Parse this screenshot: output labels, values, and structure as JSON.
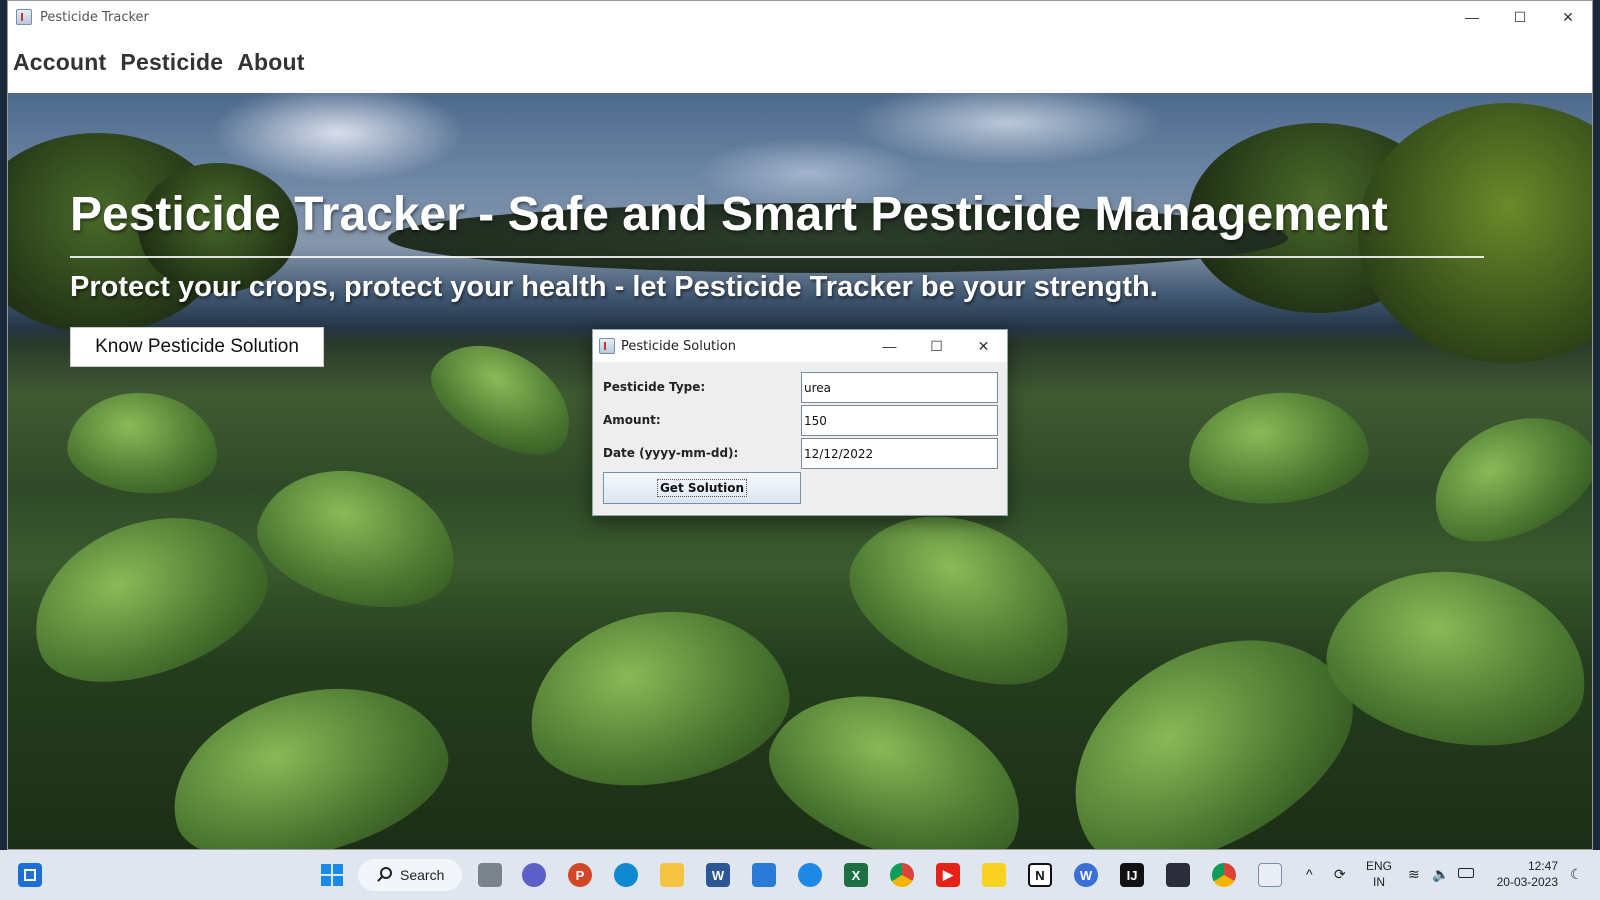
{
  "window": {
    "title": "Pesticide Tracker",
    "controls": {
      "minimize": "—",
      "maximize": "☐",
      "close": "✕"
    }
  },
  "menu": {
    "items": [
      "Account",
      "Pesticide",
      "About"
    ]
  },
  "hero": {
    "headline": "Pesticide Tracker - Safe and Smart Pesticide Management",
    "tagline": "Protect your crops, protect your health - let Pesticide Tracker be your strength.",
    "cta_label": "Know Pesticide Solution"
  },
  "dialog": {
    "title": "Pesticide Solution",
    "fields": {
      "type": {
        "label": "Pesticide Type:",
        "value": "urea"
      },
      "amount": {
        "label": "Amount:",
        "value": "150"
      },
      "date": {
        "label": "Date (yyyy-mm-dd):",
        "value": "12/12/2022"
      }
    },
    "submit_label": "Get Solution"
  },
  "taskbar": {
    "search_label": "Search",
    "apps": [
      "windows-start",
      "task-view",
      "teams",
      "powerpoint",
      "edge",
      "file-explorer",
      "word",
      "mail",
      "safari",
      "excel",
      "chrome",
      "youtube",
      "sticky-notes",
      "notion",
      "webex",
      "intellij",
      "terminal",
      "chrome-profile",
      "java-app"
    ],
    "tray": {
      "lang_top": "ENG",
      "lang_bottom": "IN",
      "time": "12:47",
      "date": "20-03-2023"
    }
  },
  "colors": {
    "taskbar": "#dfe6f0",
    "dialog_bg": "#eeeeee",
    "hero_text": "#ffffff"
  }
}
